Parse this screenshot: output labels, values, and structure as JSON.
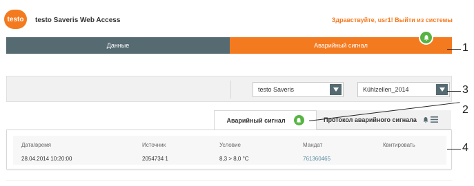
{
  "header": {
    "logo": "testo",
    "app_title": "testo Saveris Web Access",
    "greeting": "Здравствуйте,",
    "user": "usr1",
    "separator": "!",
    "logout": "Выйти из системы"
  },
  "nav": {
    "data_label": "Данные",
    "alarm_label": "Аварийный сигнал"
  },
  "filters": {
    "device": "testo Saveris",
    "group": "Kühlzellen_2014"
  },
  "tabs": {
    "active": "Аварийный сигнал",
    "inactive": "Протокол аварийного сигнала"
  },
  "table": {
    "columns": [
      "Дата/время",
      "Источник",
      "Условие",
      "Мандат",
      "Квитировать"
    ],
    "rows": [
      [
        "28.04.2014 10:20:00",
        "2054734 1",
        "8,3 > 8,0 °C",
        "761360465",
        ""
      ]
    ]
  },
  "callouts": [
    "1",
    "2",
    "3",
    "4"
  ],
  "colors": {
    "brand_orange": "#f47a20",
    "nav_slate": "#566a72",
    "bell_green": "#56b442"
  }
}
